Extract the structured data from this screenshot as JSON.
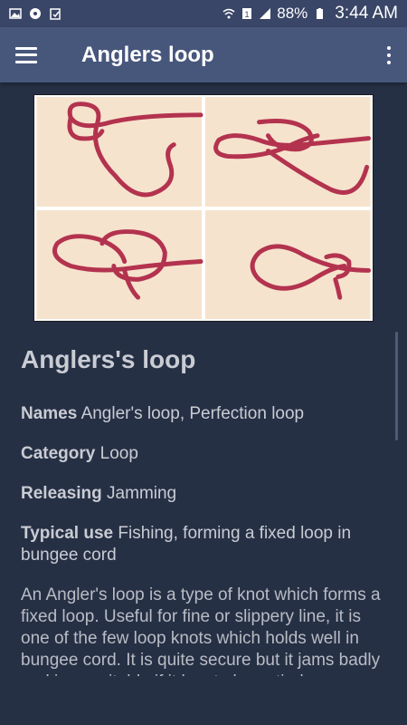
{
  "status_bar": {
    "battery": "88%",
    "time": "3:44 AM",
    "icons": [
      "image-icon",
      "cloud-icon",
      "clipboard-icon",
      "wifi-icon",
      "sim-icon",
      "signal-icon",
      "battery-icon"
    ]
  },
  "app_bar": {
    "title": "Anglers loop",
    "menu_icon": "hamburger-menu-icon",
    "overflow_icon": "more-vert-icon"
  },
  "article": {
    "heading": "Anglers's loop",
    "fields": [
      {
        "label": "Names",
        "value": "Angler's loop, Perfection loop"
      },
      {
        "label": "Category",
        "value": "Loop"
      },
      {
        "label": "Releasing",
        "value": "Jamming"
      },
      {
        "label": "Typical use",
        "value": "Fishing, forming a fixed loop in bungee cord"
      }
    ],
    "description": "An Angler's loop is a type of knot which forms a fixed loop. Useful for fine or slippery line, it is one of the few loop knots which holds well in bungee cord. It is quite secure but it jams badly and is unsuitable if it has to be untied."
  },
  "colors": {
    "status_bar": "#3a4667",
    "app_bar": "#47577c",
    "background": "#263045",
    "text": "#c9ccd3",
    "rope": "#b3334f"
  }
}
